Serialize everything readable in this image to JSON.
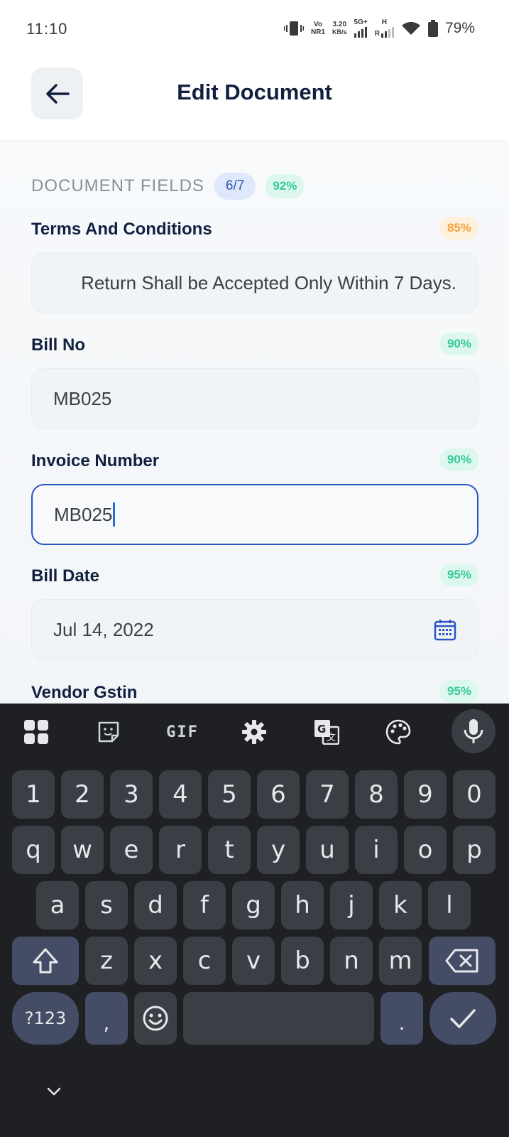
{
  "status_bar": {
    "time": "11:10",
    "network_label_top": "Vo",
    "network_label_bottom": "NR1",
    "speed_value": "3.20",
    "speed_unit": "KB/s",
    "sim1_type": "5G+",
    "sim2_type_top": "H",
    "sim2_type_bottom": "R",
    "battery": "79%"
  },
  "header": {
    "title": "Edit Document"
  },
  "section": {
    "title": "DOCUMENT FIELDS",
    "count_badge": "6/7",
    "confidence_badge": "92%"
  },
  "fields": [
    {
      "label": "Terms And Conditions",
      "confidence": "85%",
      "value": "Return Shall be Accepted Only Within 7 Days."
    },
    {
      "label": "Bill No",
      "confidence": "90%",
      "value": "MB025"
    },
    {
      "label": "Invoice Number",
      "confidence": "90%",
      "value": "MB025"
    },
    {
      "label": "Bill Date",
      "confidence": "95%",
      "value": "Jul 14, 2022"
    },
    {
      "label": "Vendor Gstin",
      "confidence": "95%",
      "value": ""
    }
  ],
  "keyboard": {
    "toolbar": [
      "apps-icon",
      "sticker-icon",
      "GIF",
      "settings-icon",
      "translate-icon",
      "palette-icon",
      "mic-icon"
    ],
    "gif_label": "GIF",
    "row_numbers": [
      "1",
      "2",
      "3",
      "4",
      "5",
      "6",
      "7",
      "8",
      "9",
      "0"
    ],
    "row1": [
      "q",
      "w",
      "e",
      "r",
      "t",
      "y",
      "u",
      "i",
      "o",
      "p"
    ],
    "row2": [
      "a",
      "s",
      "d",
      "f",
      "g",
      "h",
      "j",
      "k",
      "l"
    ],
    "row3": [
      "z",
      "x",
      "c",
      "v",
      "b",
      "n",
      "m"
    ],
    "symbols_label": "?123",
    "comma_label": ",",
    "period_label": "."
  }
}
